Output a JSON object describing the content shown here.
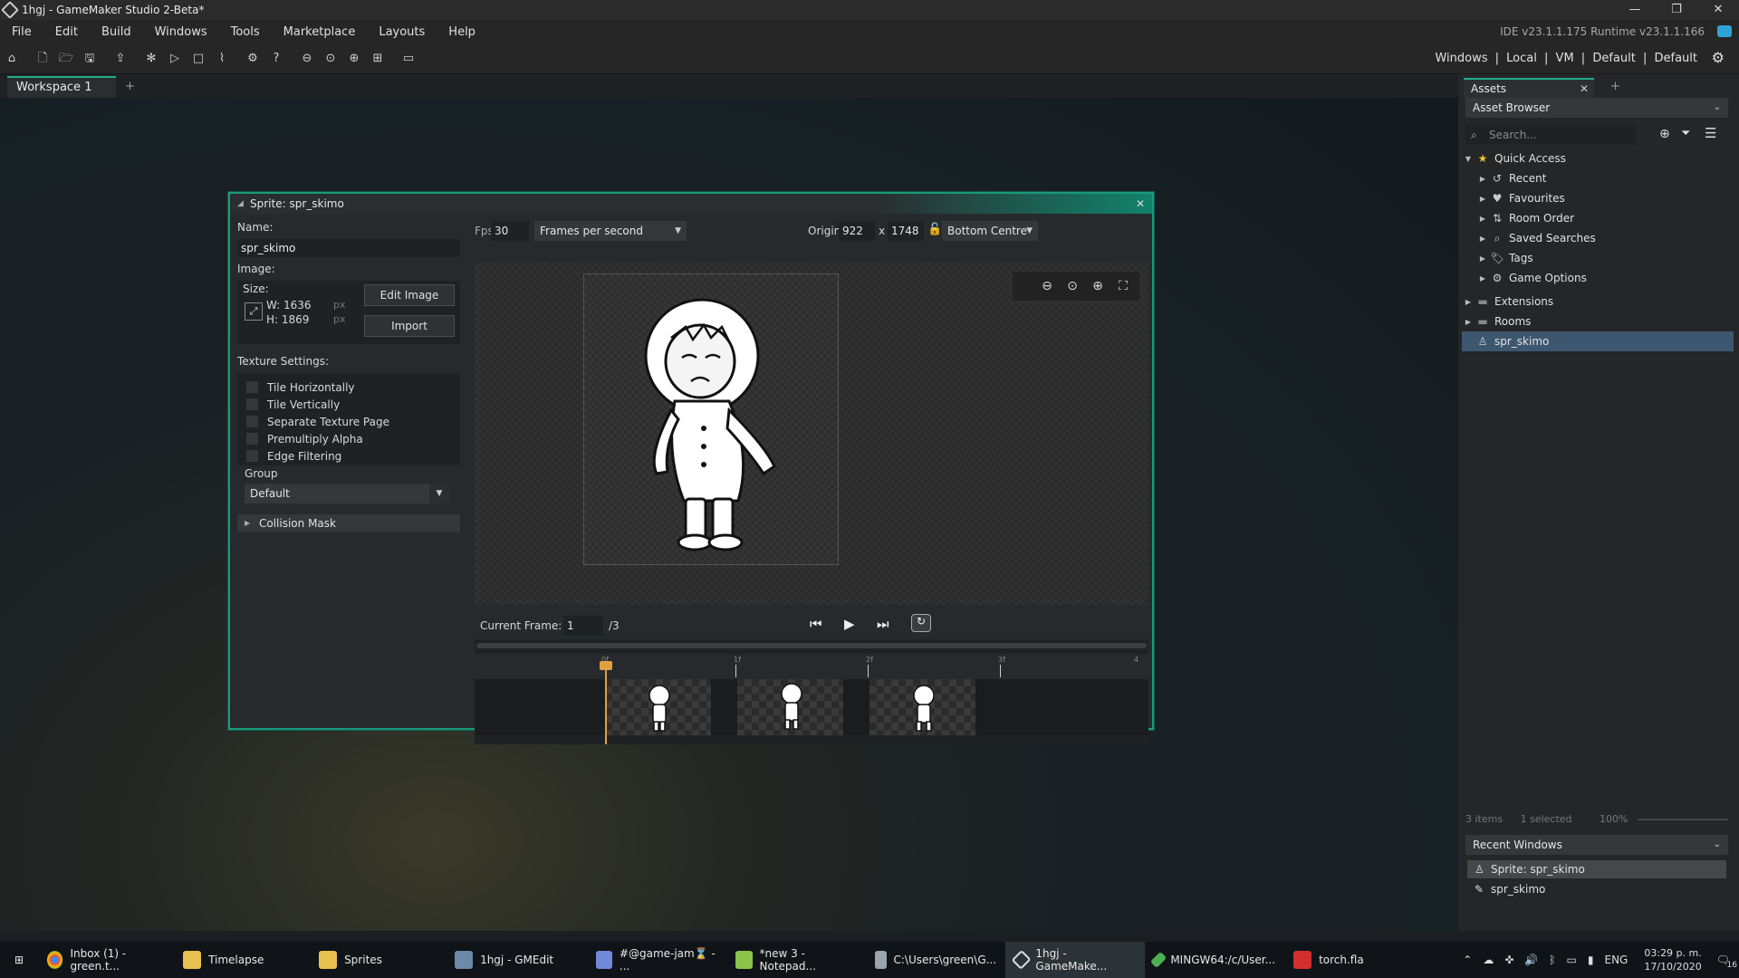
{
  "window": {
    "title": "1hgj - GameMaker Studio 2-Beta*",
    "controls": [
      "—",
      "❐",
      "✕"
    ]
  },
  "menu": {
    "items": [
      "File",
      "Edit",
      "Build",
      "Windows",
      "Tools",
      "Marketplace",
      "Layouts",
      "Help"
    ],
    "ide_version": "IDE v23.1.1.175  Runtime v23.1.1.166"
  },
  "toolbar": {
    "targets": [
      "Windows",
      "|",
      "Local",
      "|",
      "VM",
      "|",
      "Default",
      "|",
      "Default"
    ]
  },
  "workspace": {
    "tab_label": "Workspace 1",
    "add_label": "+"
  },
  "sprite_editor": {
    "title": "Sprite: spr_skimo",
    "name_label": "Name:",
    "name_value": "spr_skimo",
    "image_label": "Image:",
    "size_label": "Size:",
    "width": "W: 1636",
    "height": "H: 1869",
    "px": "px",
    "edit_image": "Edit Image",
    "import": "Import",
    "texture_settings_label": "Texture Settings:",
    "texture_options": [
      "Tile Horizontally",
      "Tile Vertically",
      "Separate Texture Page",
      "Premultiply Alpha",
      "Edge Filtering"
    ],
    "group_label": "Group",
    "group_value": "Default",
    "collision_mask": "Collision Mask",
    "fps_label": "Fps",
    "fps_value": "30",
    "fps_mode": "Frames per second",
    "origin_label": "Origin",
    "origin_x": "922",
    "origin_x_sep": "x",
    "origin_y": "1748",
    "origin_preset": "Bottom Centre",
    "current_frame_label": "Current Frame:",
    "current_frame": "1",
    "frame_total": "/3",
    "ruler_labels": [
      "0f",
      "1f",
      "2f",
      "3f",
      "4"
    ],
    "frame_count": 3
  },
  "assets": {
    "tab_label": "Assets",
    "add_label": "+",
    "browser_label": "Asset Browser",
    "search_placeholder": "Search...",
    "tree": [
      {
        "label": "Quick Access",
        "icon": "star-icon",
        "level": 0,
        "expanded": true
      },
      {
        "label": "Recent",
        "icon": "history-icon",
        "level": 1
      },
      {
        "label": "Favourites",
        "icon": "heart-icon",
        "level": 1
      },
      {
        "label": "Room Order",
        "icon": "order-icon",
        "level": 1
      },
      {
        "label": "Saved Searches",
        "icon": "search-icon",
        "level": 1
      },
      {
        "label": "Tags",
        "icon": "tag-icon",
        "level": 1
      },
      {
        "label": "Game Options",
        "icon": "gear-icon",
        "level": 1
      },
      {
        "label": "Extensions",
        "icon": "folder-icon",
        "level": 0
      },
      {
        "label": "Rooms",
        "icon": "folder-icon",
        "level": 0
      },
      {
        "label": "spr_skimo",
        "icon": "sprite-icon",
        "level": 0,
        "selected": true
      }
    ],
    "items_count": "3 items",
    "selected_count": "1 selected",
    "zoom": "100%",
    "recent_windows_label": "Recent Windows",
    "recent_windows": [
      "Sprite: spr_skimo",
      "spr_skimo"
    ]
  },
  "taskbar": {
    "items": [
      {
        "label": "Inbox (1) - green.t...",
        "color": "#e0b030"
      },
      {
        "label": "Timelapse",
        "color": "#e8c050"
      },
      {
        "label": "Sprites",
        "color": "#e8c050"
      },
      {
        "label": "1hgj - GMEdit",
        "color": "#6a8aa8"
      },
      {
        "label": "#@game-jam⌛ - ...",
        "color": "#7289da"
      },
      {
        "label": "*new 3 - Notepad...",
        "color": "#8bc34a"
      },
      {
        "label": "C:\\Users\\green\\G...",
        "color": "#9aa4ae"
      },
      {
        "label": "1hgj - GameMake...",
        "color": "#ddd"
      },
      {
        "label": "MINGW64:/c/User...",
        "color": "#4caf50"
      },
      {
        "label": "torch.fla",
        "color": "#d32f2f"
      }
    ],
    "lang": "ENG",
    "time": "03:29 p. m.",
    "date": "17/10/2020",
    "notif": "16"
  }
}
